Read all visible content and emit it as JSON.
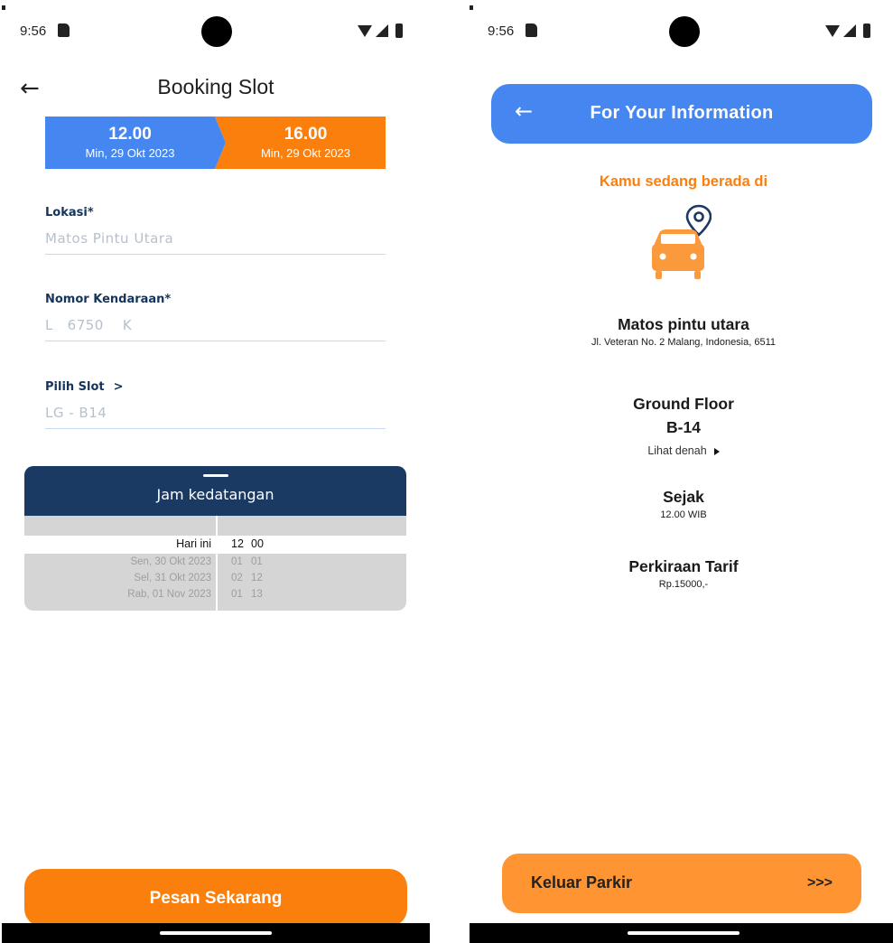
{
  "left": {
    "status": {
      "time": "9:56"
    },
    "title": "Booking Slot",
    "time_start": {
      "time": "12.00",
      "date": "Min, 29 Okt 2023"
    },
    "time_end": {
      "time": "16.00",
      "date": "Min, 29 Okt 2023"
    },
    "fields": {
      "lokasi": {
        "label": "Lokasi*",
        "value": "Matos Pintu Utara"
      },
      "nomor": {
        "label": "Nomor Kendaraan*",
        "value": "L   6750    K"
      },
      "slot": {
        "label": "Pilih Slot",
        "chevron": ">",
        "value": "LG - B14"
      }
    },
    "picker": {
      "title": "Jam kedatangan",
      "rows": [
        {
          "date": "Hari ini",
          "hour": "12",
          "minute": "00"
        },
        {
          "date": "Sen, 30 Okt 2023",
          "hour": "01",
          "minute": "01"
        },
        {
          "date": "Sel, 31 Okt 2023",
          "hour": "02",
          "minute": "12"
        },
        {
          "date": "Rab, 01 Nov 2023",
          "hour": "01",
          "minute": "13"
        }
      ]
    },
    "button": "Pesan Sekarang",
    "colors": {
      "blue": "#4586f0",
      "orange": "#fa7f0d",
      "navy": "#1b3a63"
    }
  },
  "right": {
    "status": {
      "time": "9:56"
    },
    "header": "For Your Information",
    "subtitle": "Kamu sedang berada di",
    "location": {
      "name": "Matos pintu utara",
      "address": "Jl. Veteran No. 2 Malang, Indonesia, 6511"
    },
    "floor": {
      "name": "Ground Floor",
      "slot": "B-14",
      "map_link": "Lihat denah"
    },
    "since": {
      "label": "Sejak",
      "value": "12.00 WIB"
    },
    "tariff": {
      "label": "Perkiraan Tarif",
      "value": "Rp.15000,-"
    },
    "button": {
      "label": "Keluar Parkir",
      "arrows": ">>>"
    },
    "colors": {
      "blue": "#4586f0",
      "orange": "#ff9532",
      "icon": "#fb9a3c"
    }
  }
}
